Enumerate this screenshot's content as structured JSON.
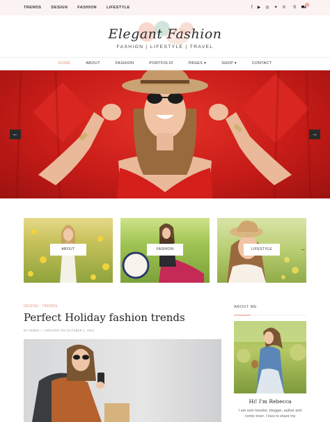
{
  "topbar": {
    "nav": [
      "TRENDS",
      "DESIGN",
      "FASHION",
      "LIFESTYLE"
    ],
    "icons": [
      "facebook-icon",
      "youtube-icon",
      "instagram-icon",
      "twitter-icon",
      "pinterest-icon",
      "search-icon",
      "cart-icon"
    ],
    "cart_count": "0"
  },
  "logo": {
    "title": "Elegant Fashion",
    "tagline": "FASHION | LIFESTYLE | TRAVEL"
  },
  "mainnav": {
    "items": [
      "HOME",
      "ABOUT",
      "FASHION",
      "PORTFOLIO",
      "PAGES",
      "SHOP",
      "CONTACT"
    ]
  },
  "hero": {
    "prev": "←",
    "next": "→"
  },
  "cards": [
    {
      "label": "ABOUT"
    },
    {
      "label": "FASHION"
    },
    {
      "label": "LIFESTYLE"
    }
  ],
  "cards_next": "→",
  "post": {
    "categories": "DESIGN  ·  TRENDS",
    "title": "Perfect Holiday fashion trends",
    "meta": "BY ADMIN   —   UPDATED ON OCTOBER 1, 2021"
  },
  "about": {
    "heading": "ABOUT ME",
    "name": "Hi! I'm Rebecca",
    "text": "I am solo traveler, blogger, author and comic lover. I love to share my"
  },
  "colors": {
    "accent": "#e8907d",
    "hero_red": "#d42a22",
    "topbar_bg": "#fbf3f1"
  }
}
